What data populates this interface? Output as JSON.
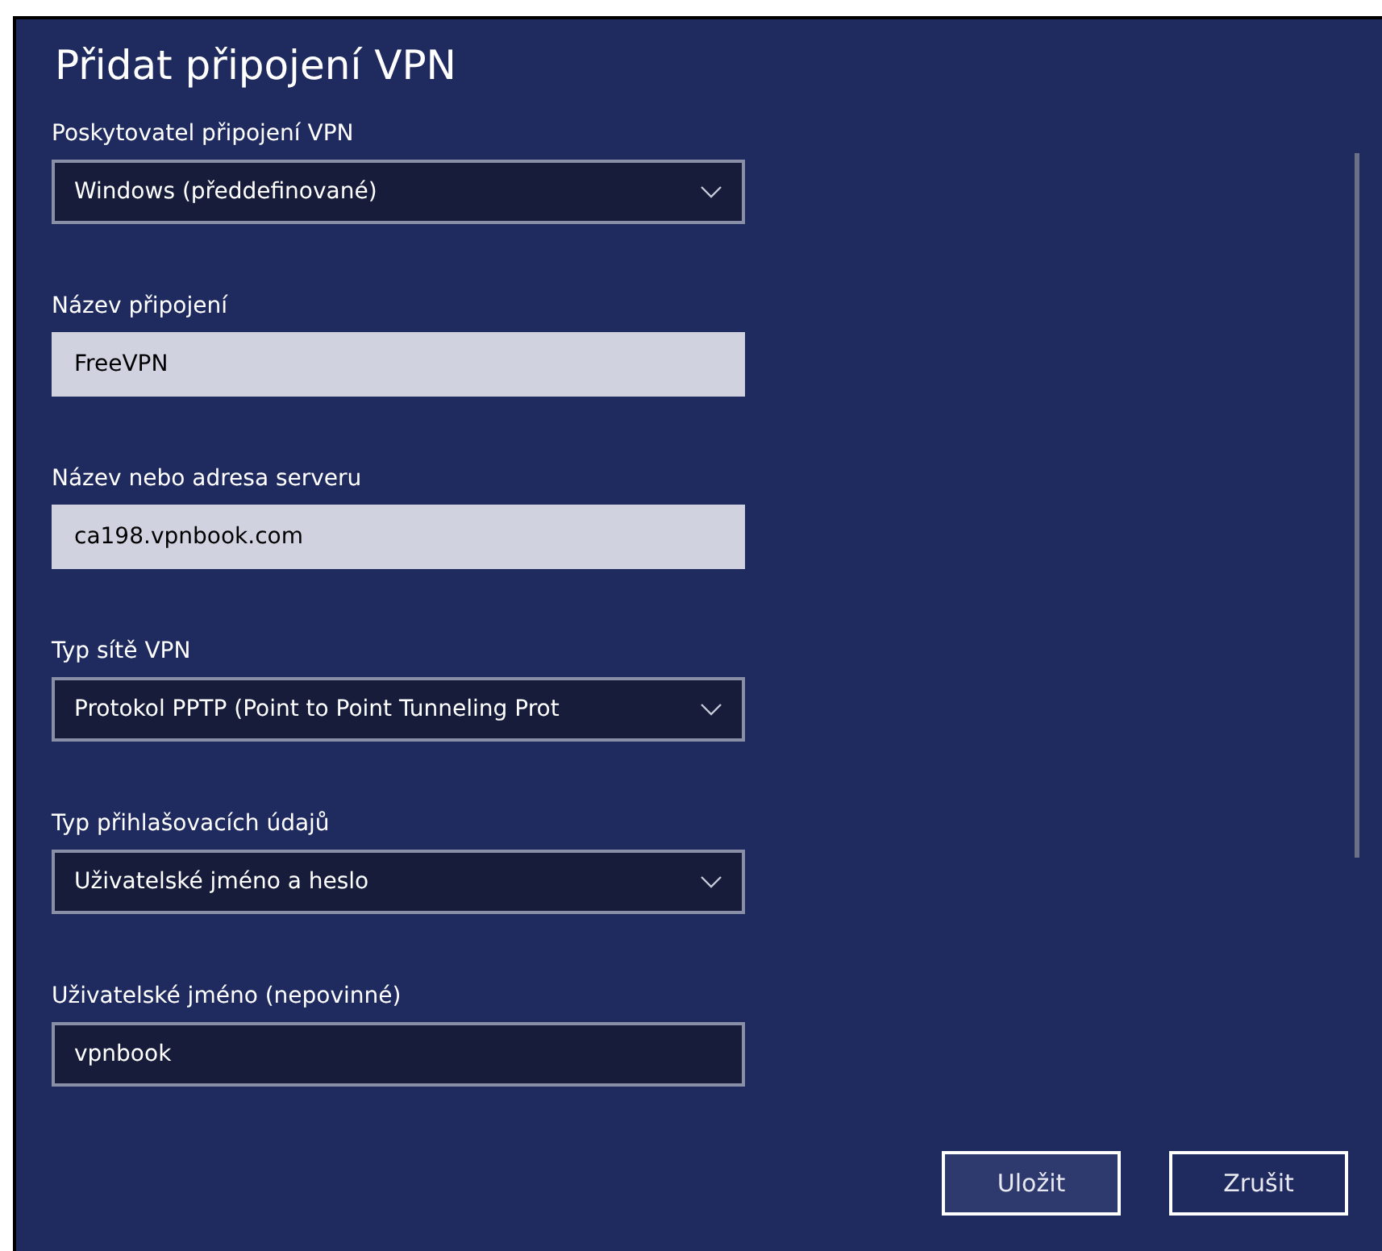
{
  "window": {
    "title": "Přidat připojení VPN"
  },
  "fields": [
    {
      "kind": "dropdown",
      "label": "Poskytovatel připojení VPN",
      "value": "Windows (předdefinované)"
    },
    {
      "kind": "text",
      "label": "Název připojení",
      "value": "FreeVPN",
      "focused": false
    },
    {
      "kind": "text",
      "label": "Název nebo adresa serveru",
      "value": "ca198.vpnbook.com",
      "focused": false
    },
    {
      "kind": "dropdown",
      "label": "Typ sítě VPN",
      "value": "Protokol PPTP (Point to Point Tunneling Prot"
    },
    {
      "kind": "dropdown",
      "label": "Typ přihlašovacích údajů",
      "value": "Uživatelské jméno a heslo"
    },
    {
      "kind": "text",
      "label": "Uživatelské jméno (nepovinné)",
      "value": "vpnbook",
      "focused": true
    }
  ],
  "buttons": [
    {
      "label": "Uložit",
      "default": true
    },
    {
      "label": "Zrušit",
      "default": false
    }
  ]
}
